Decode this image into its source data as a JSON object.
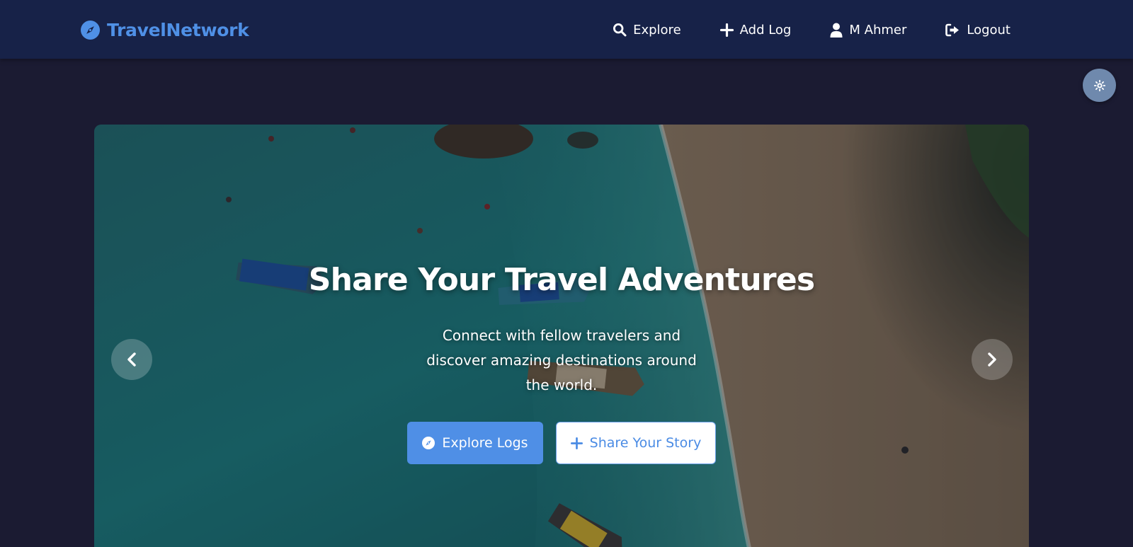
{
  "brand": {
    "name": "TravelNetwork",
    "icon": "compass-icon",
    "color": "#4f90e6"
  },
  "nav": {
    "links": [
      {
        "label": "Explore",
        "icon": "search-icon"
      },
      {
        "label": "Add Log",
        "icon": "plus-icon"
      },
      {
        "label": "M Ahmer",
        "icon": "user-icon"
      },
      {
        "label": "Logout",
        "icon": "logout-icon"
      }
    ]
  },
  "theme_toggle": {
    "icon": "sun-icon"
  },
  "hero": {
    "title": "Share Your Travel Adventures",
    "subtitle": "Connect with fellow travelers and discover amazing destinations around the world.",
    "primary_button": {
      "label": "Explore Logs",
      "icon": "compass-icon"
    },
    "secondary_button": {
      "label": "Share Your Story",
      "icon": "plus-icon"
    },
    "prev_icon": "chevron-left-icon",
    "next_icon": "chevron-right-icon"
  },
  "colors": {
    "page_bg": "#1b1b32",
    "navbar_bg": "#172248",
    "accent": "#4f8fe6",
    "toggle_bg": "#6f89ad"
  }
}
